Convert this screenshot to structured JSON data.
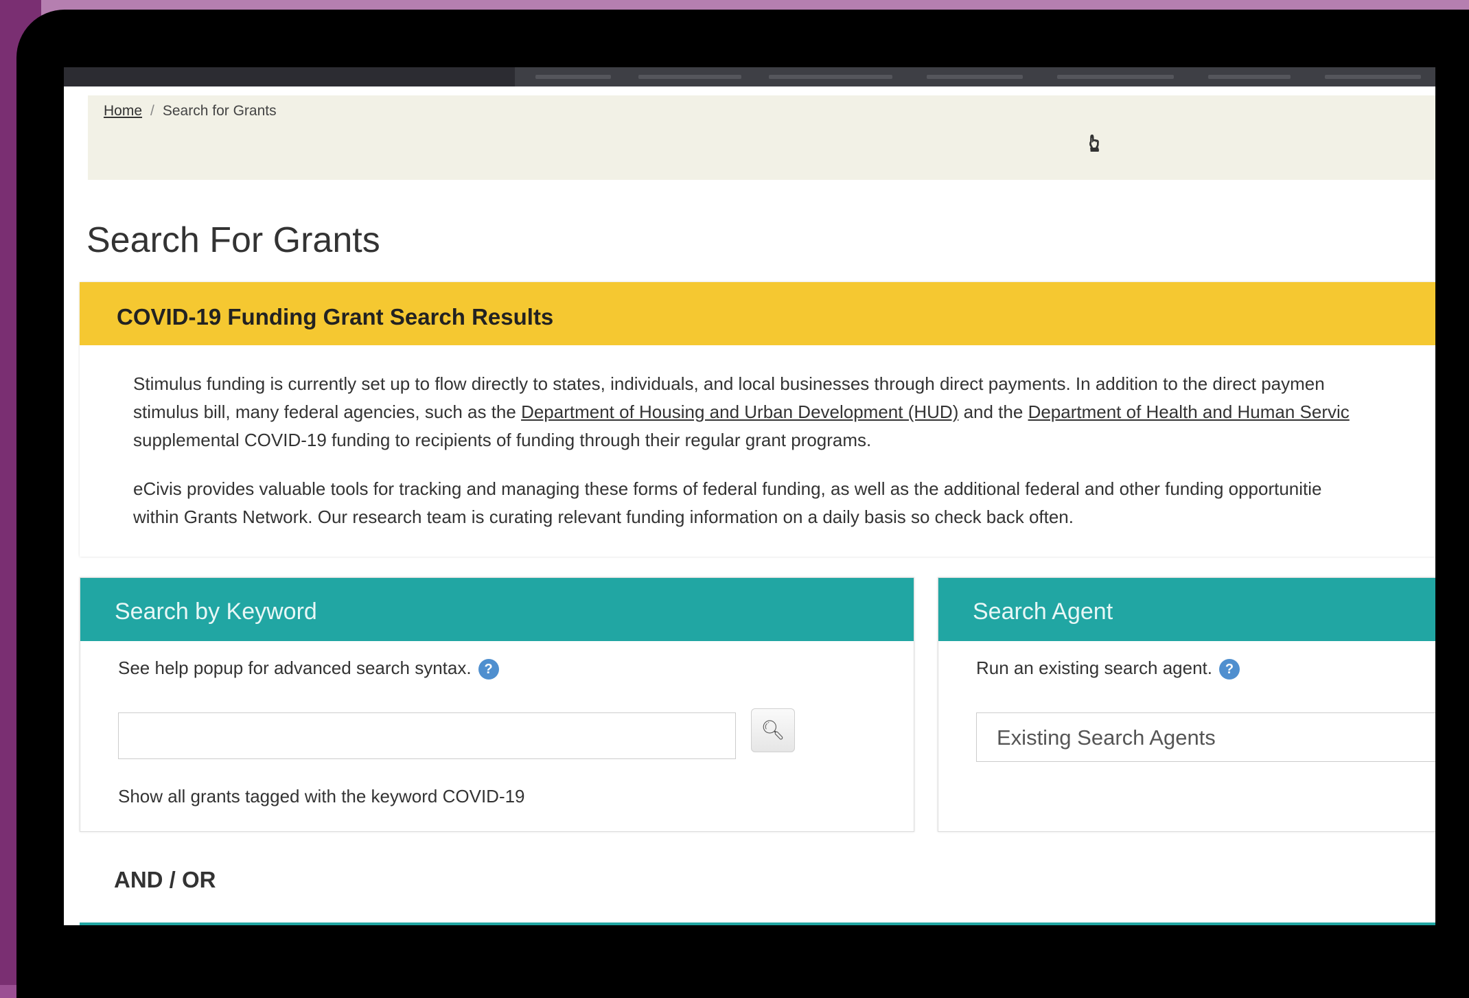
{
  "breadcrumb": {
    "home": "Home",
    "separator": "/",
    "current": "Search for Grants"
  },
  "page": {
    "title": "Search For Grants"
  },
  "notice": {
    "title": "COVID-19 Funding Grant Search Results",
    "p1_line1": "Stimulus funding is currently set up to flow directly to states, individuals, and local businesses through direct payments. In addition to the direct paymen",
    "p1_line2_prefix": "stimulus bill, many federal agencies, such as the ",
    "link_hud": "Department of Housing and Urban Development (HUD)",
    "p1_line2_mid": " and the ",
    "link_hhs": "Department of Health and Human Servic",
    "p1_line3": "supplemental COVID-19 funding to recipients of funding through their regular grant programs.",
    "p2_line1": "eCivis provides valuable tools for tracking and managing these forms of federal funding, as well as the additional federal and other funding opportunitie",
    "p2_line2": "within Grants Network. Our research team is curating relevant funding information on a daily basis so check back often."
  },
  "keyword_card": {
    "title": "Search by Keyword",
    "help_text": "See help popup for advanced search syntax.",
    "input_value": "",
    "covid_link": "Show all grants tagged with the keyword COVID-19"
  },
  "agent_card": {
    "title": "Search Agent",
    "help_text": "Run an existing search agent.",
    "select_value": "Existing Search Agents"
  },
  "and_or": "AND / OR",
  "icons": {
    "help": "question-mark-icon",
    "search": "magnifier-icon",
    "cursor": "mouse-pointer-icon"
  },
  "colors": {
    "accent_teal": "#21a6a3",
    "notice_yellow": "#f5c831",
    "breadcrumb_bg": "#f2f1e6",
    "frame_purple": "#9b4f93"
  }
}
